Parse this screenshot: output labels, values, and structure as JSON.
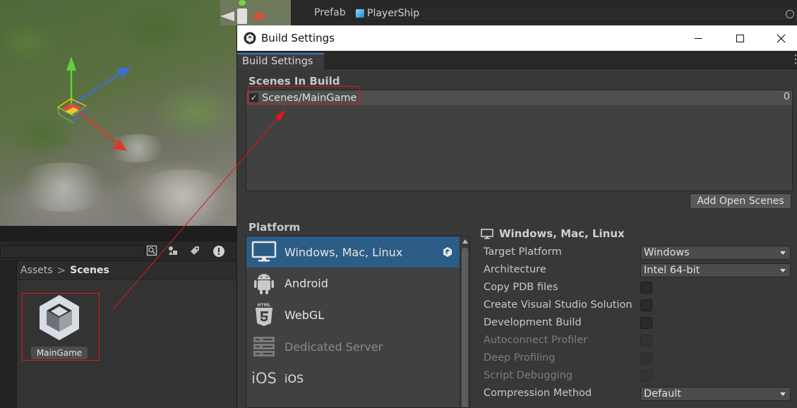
{
  "inspector": {
    "prefab_label": "Prefab",
    "prefab_value": "PlayerShip"
  },
  "project": {
    "breadcrumb": [
      "Assets",
      "Scenes"
    ],
    "breadcrumb_separator": ">",
    "asset_name": "MainGame"
  },
  "window": {
    "title": "Build Settings",
    "tab_label": "Build Settings"
  },
  "scenes": {
    "title": "Scenes In Build",
    "items": [
      {
        "name": "Scenes/MainGame",
        "index": "0",
        "checked": true
      }
    ],
    "add_button": "Add Open Scenes"
  },
  "platform": {
    "title": "Platform",
    "items": [
      {
        "label": "Windows, Mac, Linux",
        "icon": "monitor-icon",
        "selected": true,
        "enabled": true
      },
      {
        "label": "Android",
        "icon": "android-icon",
        "selected": false,
        "enabled": true
      },
      {
        "label": "WebGL",
        "icon": "html5-icon",
        "icon_text": "HTML",
        "selected": false,
        "enabled": true
      },
      {
        "label": "Dedicated Server",
        "icon": "server-icon",
        "selected": false,
        "enabled": false
      },
      {
        "label": "iOS",
        "icon": "ios-icon",
        "icon_text": "iOS",
        "selected": false,
        "enabled": true
      }
    ]
  },
  "settings": {
    "header": "Windows, Mac, Linux",
    "rows": [
      {
        "label": "Target Platform",
        "type": "dropdown",
        "value": "Windows",
        "enabled": true
      },
      {
        "label": "Architecture",
        "type": "dropdown",
        "value": "Intel 64-bit",
        "enabled": true
      },
      {
        "label": "Copy PDB files",
        "type": "checkbox",
        "checked": false,
        "enabled": true
      },
      {
        "label": "Create Visual Studio Solution",
        "type": "checkbox",
        "checked": false,
        "enabled": true
      },
      {
        "label": "Development Build",
        "type": "checkbox",
        "checked": false,
        "enabled": true
      },
      {
        "label": "Autoconnect Profiler",
        "type": "checkbox",
        "checked": false,
        "enabled": false
      },
      {
        "label": "Deep Profiling",
        "type": "checkbox",
        "checked": false,
        "enabled": false
      },
      {
        "label": "Script Debugging",
        "type": "checkbox",
        "checked": false,
        "enabled": false
      },
      {
        "label": "Compression Method",
        "type": "dropdown",
        "value": "Default",
        "enabled": true
      }
    ]
  },
  "colors": {
    "selection": "#2c5d87",
    "annotation": "#e0161b",
    "tab_accent": "#3a79bb"
  }
}
